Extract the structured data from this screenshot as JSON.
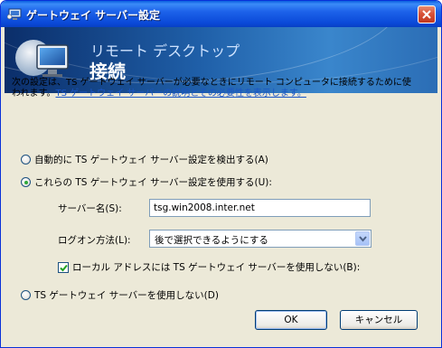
{
  "window": {
    "title": "ゲートウェイ サーバー設定"
  },
  "banner": {
    "subtitle": "リモート デスクトップ",
    "title": "接続"
  },
  "description": {
    "line1": "次の設定は、TS ゲートウェイ サーバーが必要なときにリモート コンピュータに接続するために使",
    "line2_prefix": "われます。",
    "line2_link": "TS ゲートウェイ サーバーの説明とその必要性を表示します。"
  },
  "options": {
    "auto_detect": "自動的に TS ゲートウェイ サーバー設定を検出する(A)",
    "use_settings": "これらの TS ゲートウェイ サーバー設定を使用する(U):",
    "do_not_use": "TS ゲートウェイ サーバーを使用しない(D)"
  },
  "server": {
    "label": "サーバー名(S):",
    "value": "tsg.win2008.inter.net"
  },
  "logon": {
    "label": "ログオン方法(L):",
    "value": "後で選択できるようにする"
  },
  "bypass_local": {
    "label": "ローカル アドレスには TS ゲートウェイ サーバーを使用しない(B):",
    "checked": true
  },
  "buttons": {
    "ok": "OK",
    "cancel": "キャンセル"
  },
  "colors": {
    "titlebar": "#0a49d8",
    "link": "#1a55c5",
    "dialog_bg": "#ece9d8"
  }
}
